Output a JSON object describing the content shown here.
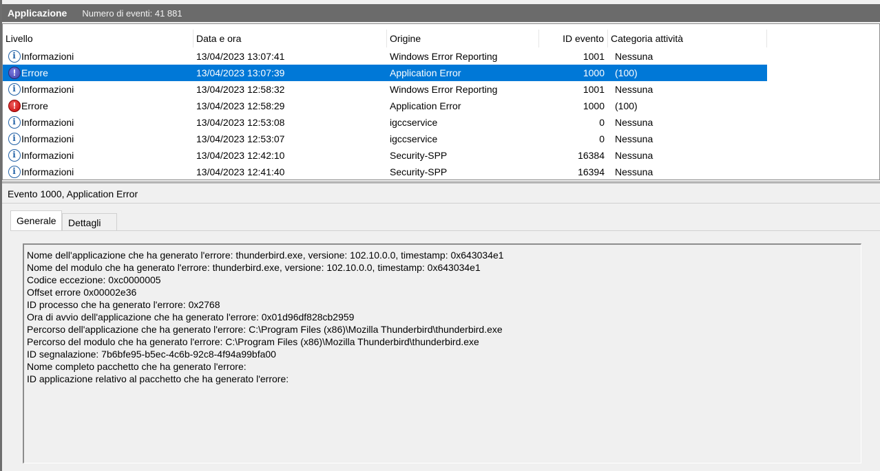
{
  "title_bar": {
    "title": "Applicazione",
    "count": "Numero di eventi: 41 881"
  },
  "columns": [
    "Livello",
    "Data e ora",
    "Origine",
    "ID evento",
    "Categoria attività"
  ],
  "events": [
    {
      "level": "Informazioni",
      "icon": "info-icon",
      "datetime": "13/04/2023 13:07:41",
      "source": "Windows Error Reporting",
      "id": "1001",
      "category": "Nessuna",
      "selected": false
    },
    {
      "level": "Errore",
      "icon": "error-icon",
      "datetime": "13/04/2023 13:07:39",
      "source": "Application Error",
      "id": "1000",
      "category": "(100)",
      "selected": true
    },
    {
      "level": "Informazioni",
      "icon": "info-icon",
      "datetime": "13/04/2023 12:58:32",
      "source": "Windows Error Reporting",
      "id": "1001",
      "category": "Nessuna",
      "selected": false
    },
    {
      "level": "Errore",
      "icon": "error-icon",
      "datetime": "13/04/2023 12:58:29",
      "source": "Application Error",
      "id": "1000",
      "category": "(100)",
      "selected": false
    },
    {
      "level": "Informazioni",
      "icon": "info-icon",
      "datetime": "13/04/2023 12:53:08",
      "source": "igccservice",
      "id": "0",
      "category": "Nessuna",
      "selected": false
    },
    {
      "level": "Informazioni",
      "icon": "info-icon",
      "datetime": "13/04/2023 12:53:07",
      "source": "igccservice",
      "id": "0",
      "category": "Nessuna",
      "selected": false
    },
    {
      "level": "Informazioni",
      "icon": "info-icon",
      "datetime": "13/04/2023 12:42:10",
      "source": "Security-SPP",
      "id": "16384",
      "category": "Nessuna",
      "selected": false
    },
    {
      "level": "Informazioni",
      "icon": "info-icon",
      "datetime": "13/04/2023 12:41:40",
      "source": "Security-SPP",
      "id": "16394",
      "category": "Nessuna",
      "selected": false
    }
  ],
  "detail": {
    "header": "Evento 1000, Application Error",
    "tabs": [
      "Generale",
      "Dettagli"
    ],
    "lines": [
      "Nome dell'applicazione che ha generato l'errore: thunderbird.exe, versione: 102.10.0.0, timestamp: 0x643034e1",
      "Nome del modulo che ha generato l'errore: thunderbird.exe, versione: 102.10.0.0, timestamp: 0x643034e1",
      "Codice eccezione: 0xc0000005",
      "Offset errore 0x00002e36",
      "ID processo che ha generato l'errore: 0x2768",
      "Ora di avvio dell'applicazione che ha generato l'errore: 0x01d96df828cb2959",
      "Percorso dell'applicazione che ha generato l'errore: C:\\Program Files (x86)\\Mozilla Thunderbird\\thunderbird.exe",
      "Percorso del modulo che ha generato l'errore: C:\\Program Files (x86)\\Mozilla Thunderbird\\thunderbird.exe",
      "ID segnalazione: 7b6bfe95-b5ec-4c6b-92c8-4f94a99bfa00",
      "Nome completo pacchetto che ha generato l'errore:",
      "ID applicazione relativo al pacchetto che ha generato l'errore:"
    ]
  },
  "colors": {
    "selection": "#0078d7",
    "title_bar": "#6b6b6b",
    "error": "#c40000",
    "info": "#1f5fa5"
  }
}
